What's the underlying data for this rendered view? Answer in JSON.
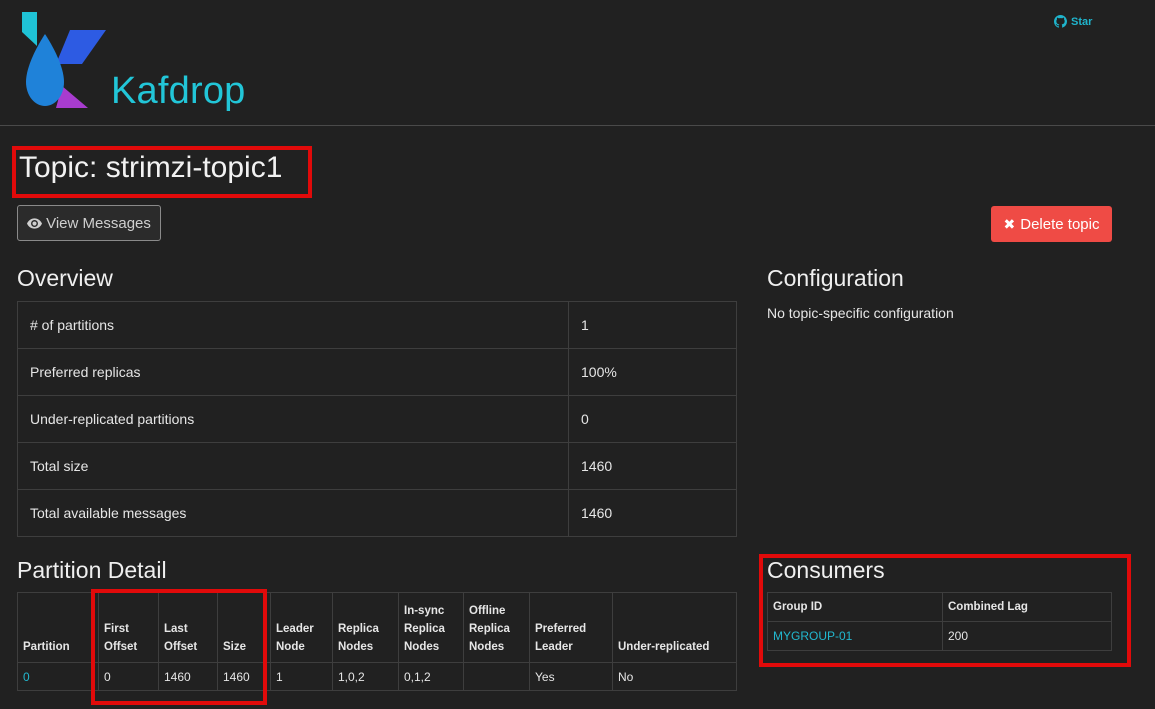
{
  "header": {
    "brand": "Kafdrop",
    "star_label": "Star"
  },
  "page": {
    "title": "Topic: strimzi-topic1"
  },
  "buttons": {
    "view_messages": "View Messages",
    "delete_topic": "Delete topic"
  },
  "overview": {
    "heading": "Overview",
    "rows": [
      {
        "label": "# of partitions",
        "value": "1"
      },
      {
        "label": "Preferred replicas",
        "value": "100%"
      },
      {
        "label": "Under-replicated partitions",
        "value": "0"
      },
      {
        "label": "Total size",
        "value": "1460"
      },
      {
        "label": "Total available messages",
        "value": "1460"
      }
    ]
  },
  "configuration": {
    "heading": "Configuration",
    "text": "No topic-specific configuration"
  },
  "partition_detail": {
    "heading": "Partition Detail",
    "columns": {
      "partition": "Partition",
      "first_offset": [
        "First",
        "Offset"
      ],
      "last_offset": [
        "Last",
        "Offset"
      ],
      "size": "Size",
      "leader_node": [
        "Leader",
        "Node"
      ],
      "replica_nodes": [
        "Replica",
        "Nodes"
      ],
      "insync_replica_nodes": [
        "In-sync",
        "Replica",
        "Nodes"
      ],
      "offline_replica_nodes": [
        "Offline",
        "Replica",
        "Nodes"
      ],
      "preferred_leader": [
        "Preferred",
        "Leader"
      ],
      "under_replicated": "Under-replicated"
    },
    "rows": [
      {
        "partition": "0",
        "first_offset": "0",
        "last_offset": "1460",
        "size": "1460",
        "leader_node": "1",
        "replica_nodes": "1,0,2",
        "insync_replica_nodes": "0,1,2",
        "offline_replica_nodes": "",
        "preferred_leader": "Yes",
        "under_replicated": "No"
      }
    ]
  },
  "consumers": {
    "heading": "Consumers",
    "columns": {
      "group_id": "Group ID",
      "combined_lag": "Combined Lag"
    },
    "rows": [
      {
        "group_id": "MYGROUP-01",
        "combined_lag": "200"
      }
    ]
  },
  "colors": {
    "brand": "#22c6d8",
    "link": "#22b8cf",
    "delete": "#ef4b45",
    "highlight": "#e10a0a"
  }
}
